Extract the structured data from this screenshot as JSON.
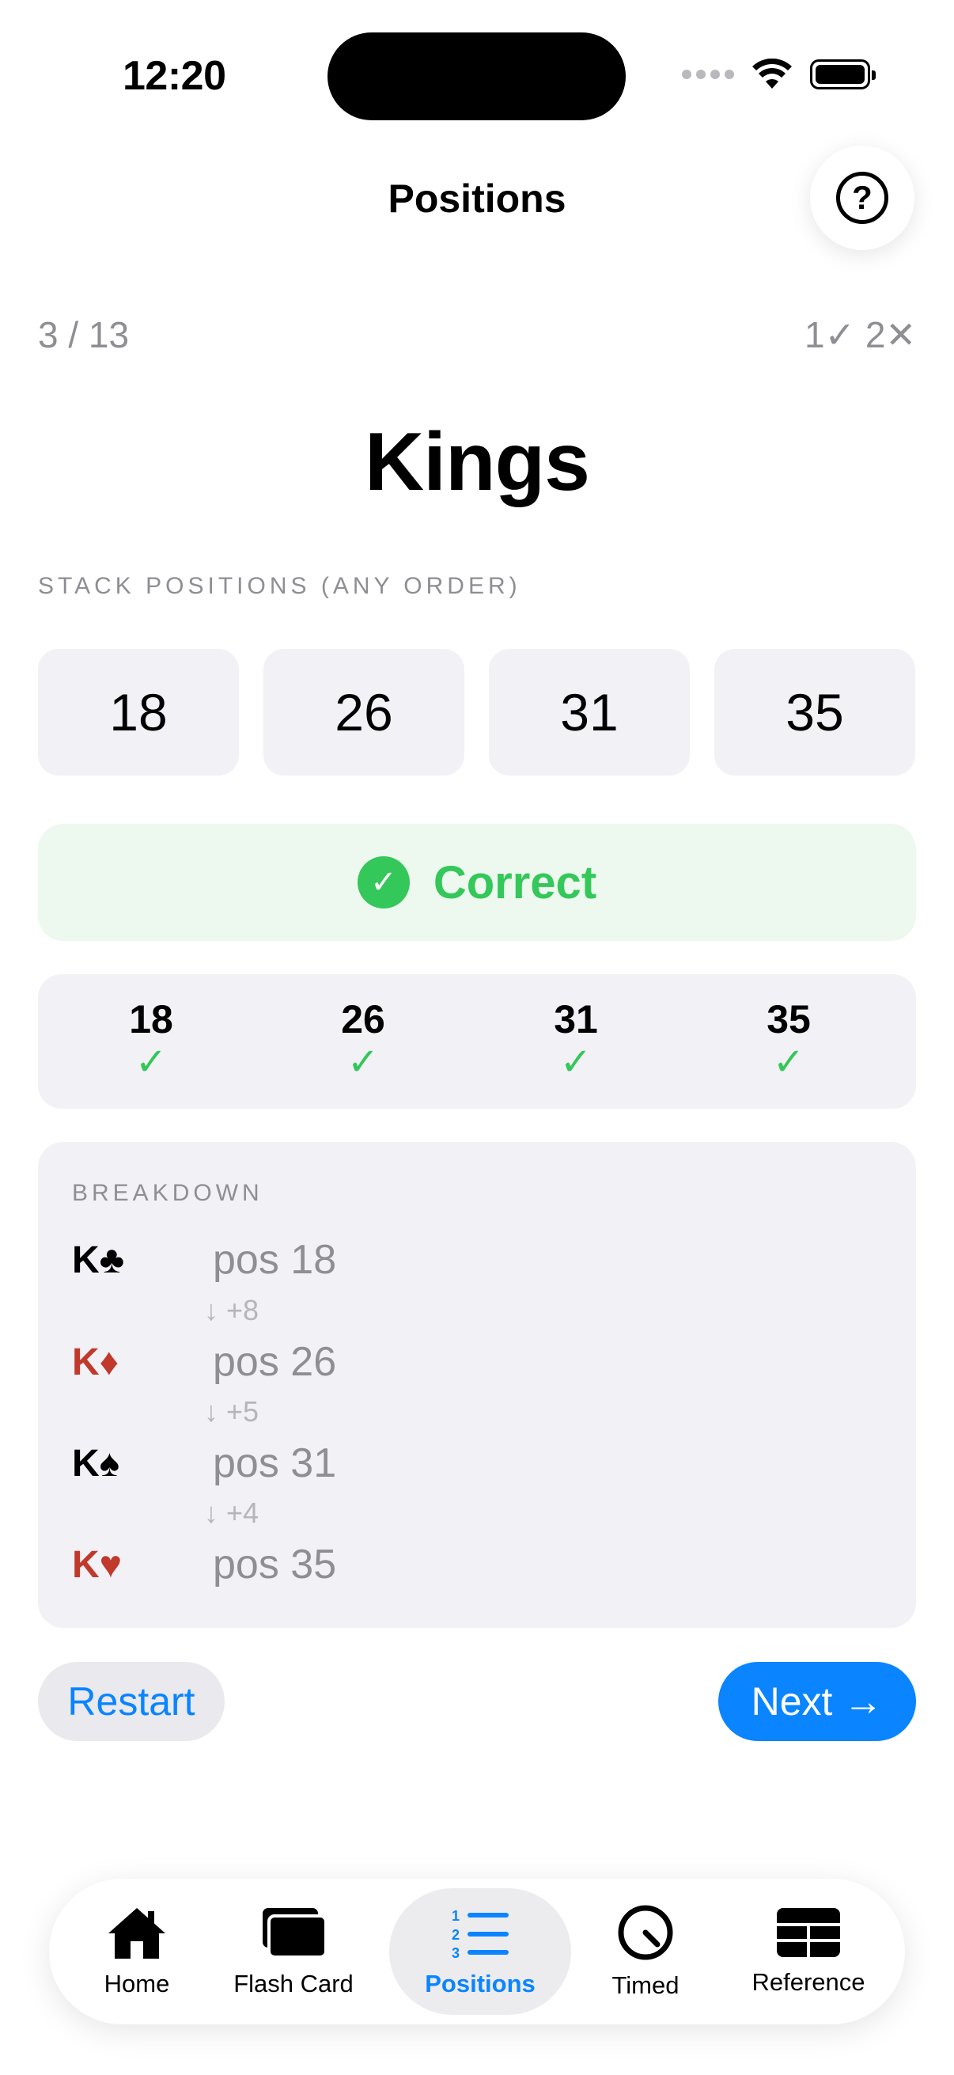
{
  "status": {
    "time": "12:20"
  },
  "nav": {
    "title": "Positions",
    "help_symbol": "?"
  },
  "progress": {
    "counter": "3 / 13",
    "score": "1✓  2✕"
  },
  "card": {
    "title": "Kings"
  },
  "stack": {
    "label": "STACK POSITIONS (ANY ORDER)",
    "positions": [
      "18",
      "26",
      "31",
      "35"
    ]
  },
  "feedback": {
    "text": "Correct",
    "color": "#34c759"
  },
  "results": [
    {
      "value": "18",
      "mark": "✓"
    },
    {
      "value": "26",
      "mark": "✓"
    },
    {
      "value": "31",
      "mark": "✓"
    },
    {
      "value": "35",
      "mark": "✓"
    }
  ],
  "breakdown": {
    "label": "BREAKDOWN",
    "rows": [
      {
        "card": "K♣",
        "pos": "pos 18",
        "suit_color": "black"
      },
      {
        "card": "K♦",
        "pos": "pos 26",
        "suit_color": "red"
      },
      {
        "card": "K♠",
        "pos": "pos 31",
        "suit_color": "black"
      },
      {
        "card": "K♥",
        "pos": "pos 35",
        "suit_color": "red"
      }
    ],
    "diffs": [
      "↓ +8",
      "↓ +5",
      "↓ +4"
    ]
  },
  "actions": {
    "restart_label": "Restart",
    "next_label": "Next →"
  },
  "tabs": [
    {
      "label": "Home",
      "icon": "house-icon"
    },
    {
      "label": "Flash Card",
      "icon": "cards-icon"
    },
    {
      "label": "Positions",
      "icon": "numbered-list-icon",
      "active": true
    },
    {
      "label": "Timed",
      "icon": "timer-icon"
    },
    {
      "label": "Reference",
      "icon": "table-icon"
    }
  ],
  "colors": {
    "accent": "#0a84ff",
    "success": "#34c759",
    "red_suit": "#c0392b"
  }
}
